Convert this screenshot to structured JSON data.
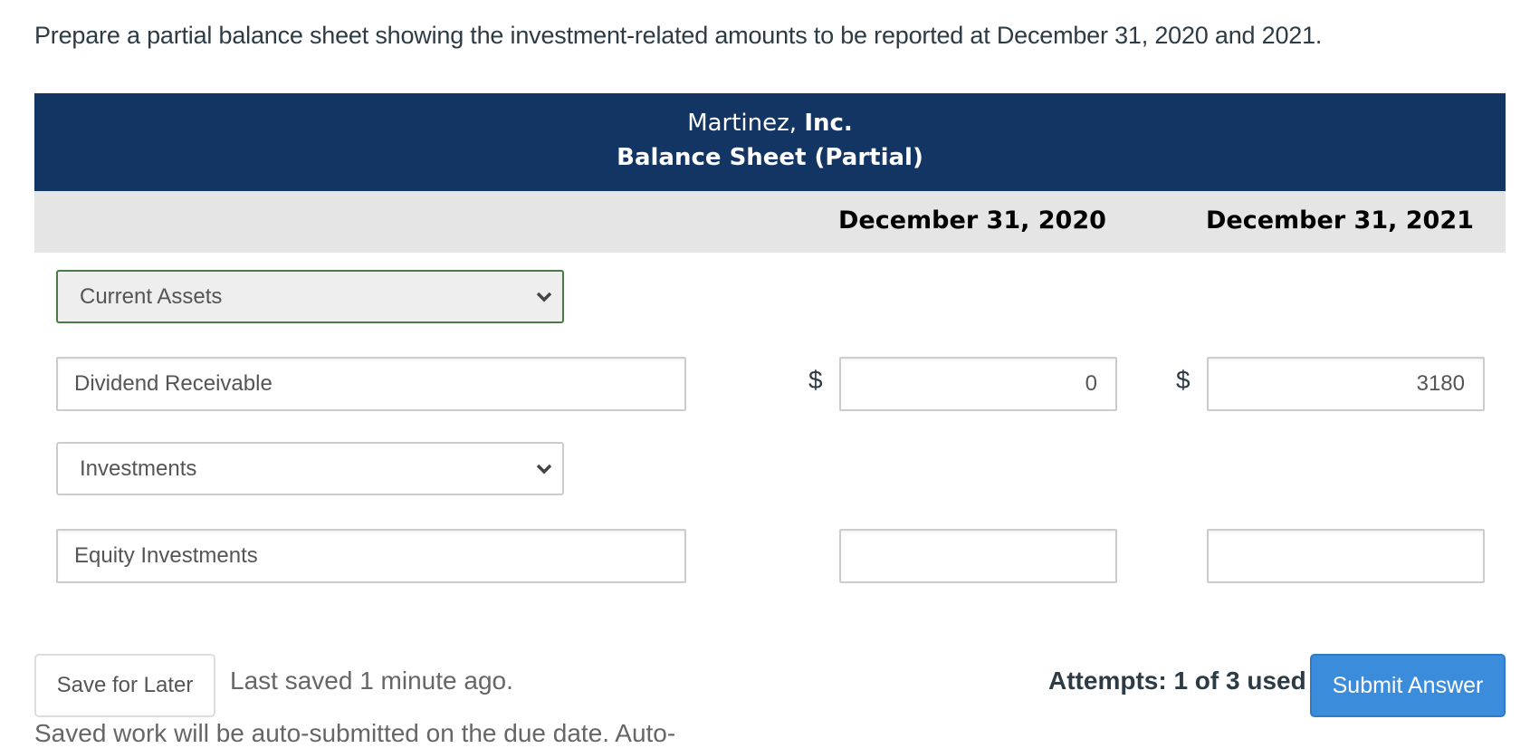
{
  "prompt": "Prepare a partial balance sheet showing the investment-related amounts to be reported at December 31, 2020 and 2021.",
  "statement": {
    "company_name": "Martinez,",
    "company_suffix": "Inc.",
    "title": "Balance Sheet (Partial)",
    "columns": [
      "December 31, 2020",
      "December 31, 2021"
    ]
  },
  "rows": [
    {
      "type": "section-select",
      "selected": "Current Assets"
    },
    {
      "type": "line-item",
      "label": "Dividend Receivable",
      "currency_symbol": "$",
      "values": [
        "0",
        "3180"
      ]
    },
    {
      "type": "section-select",
      "selected": "Investments"
    },
    {
      "type": "line-item",
      "label": "Equity Investments",
      "currency_symbol": "",
      "values": [
        "",
        ""
      ]
    }
  ],
  "footer": {
    "save_label": "Save for Later",
    "last_saved": "Last saved 1 minute ago.",
    "auto_note": "Saved work will be auto-submitted on the due date. Auto-",
    "attempts": "Attempts: 1 of 3 used",
    "submit_label": "Submit Answer"
  },
  "colors": {
    "header_bg": "#133563",
    "submit_bg": "#3b8cda",
    "active_select_border": "#4a7a46"
  }
}
